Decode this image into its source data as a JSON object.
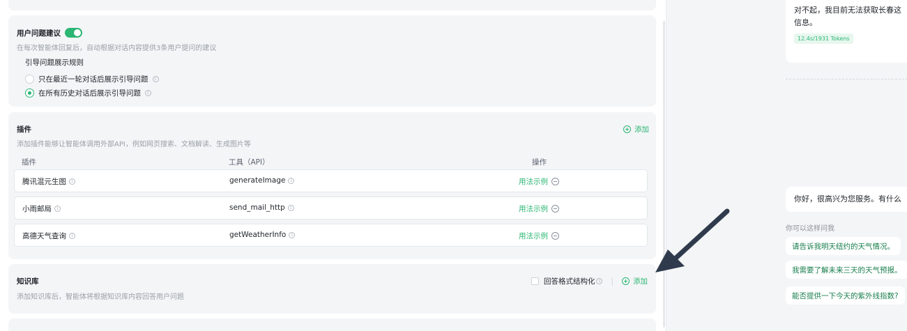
{
  "suggestions": {
    "title": "用户问题建议",
    "enabled": true,
    "description": "在每次智能体回复后，自动根据对话内容提供3条用户提问的建议",
    "rule_label": "引导问题展示规则",
    "options": [
      {
        "label": "只在最近一轮对话后展示引导问题",
        "selected": false
      },
      {
        "label": "在所有历史对话后展示引导问题",
        "selected": true
      }
    ]
  },
  "plugins": {
    "title": "插件",
    "add_label": "添加",
    "description": "添加插件能够让智能体调用外部API，例如网页搜索、文档解读、生成图片等",
    "columns": [
      "插件",
      "工具（API）",
      "操作"
    ],
    "rows": [
      {
        "name": "腾讯混元生图",
        "tool": "generateImage",
        "action": "用法示例"
      },
      {
        "name": "小雨邮局",
        "tool": "send_mail_http",
        "action": "用法示例"
      },
      {
        "name": "高德天气查询",
        "tool": "getWeatherInfo",
        "action": "用法示例"
      }
    ]
  },
  "knowledge": {
    "title": "知识库",
    "description": "添加知识库后，智能体将根据知识库内容回答用户问题",
    "structured_label": "回答格式结构化",
    "add_label": "添加"
  },
  "chat": {
    "reply1_line1": "对不起，我目前无法获取长春这",
    "reply1_line2": "信息。",
    "tokens": "12.4s/1931 Tokens",
    "reply2": "你好，很高兴为您服务。有什么",
    "ask_label": "你可以这样问我",
    "suggested": [
      "请告诉我明天纽约的天气情况。",
      "我需要了解未来三天的天气预报。",
      "能否提供一下今天的紫外线指数?"
    ]
  },
  "colors": {
    "accent": "#2bb673",
    "arrow": "#2f3b4c"
  }
}
